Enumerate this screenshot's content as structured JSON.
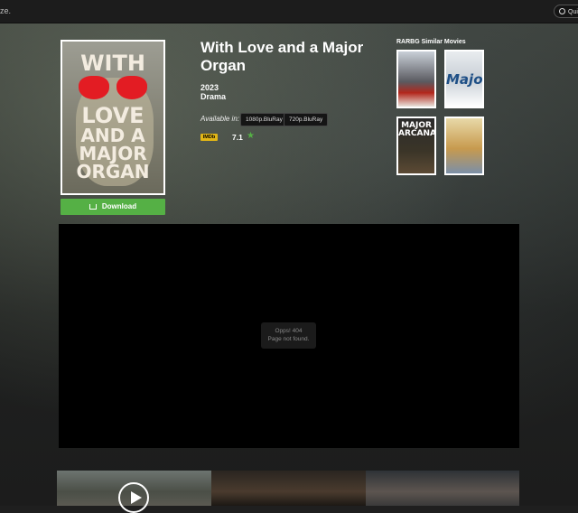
{
  "header": {
    "logo_fragment": "ze.",
    "search_label": "Qui"
  },
  "movie": {
    "title": "With Love and a Major Organ",
    "year": "2023",
    "genre": "Drama",
    "available_label": "Available in:",
    "qualities": [
      "1080p.BluRay",
      "720p.BluRay"
    ],
    "imdb_badge": "IMDb",
    "rating": "7.1",
    "download_label": "Download",
    "poster_lines": [
      "WITH",
      "LOVE",
      "AND A",
      "MAJOR",
      "ORGAN"
    ]
  },
  "similar": {
    "heading": "RARBG Similar Movies",
    "posters": [
      {
        "text": ""
      },
      {
        "text": "Major"
      },
      {
        "text": "MAJOR ARCANA"
      },
      {
        "text": ""
      }
    ]
  },
  "player": {
    "error_line1": "Opps! 404",
    "error_line2": "Page not found."
  }
}
